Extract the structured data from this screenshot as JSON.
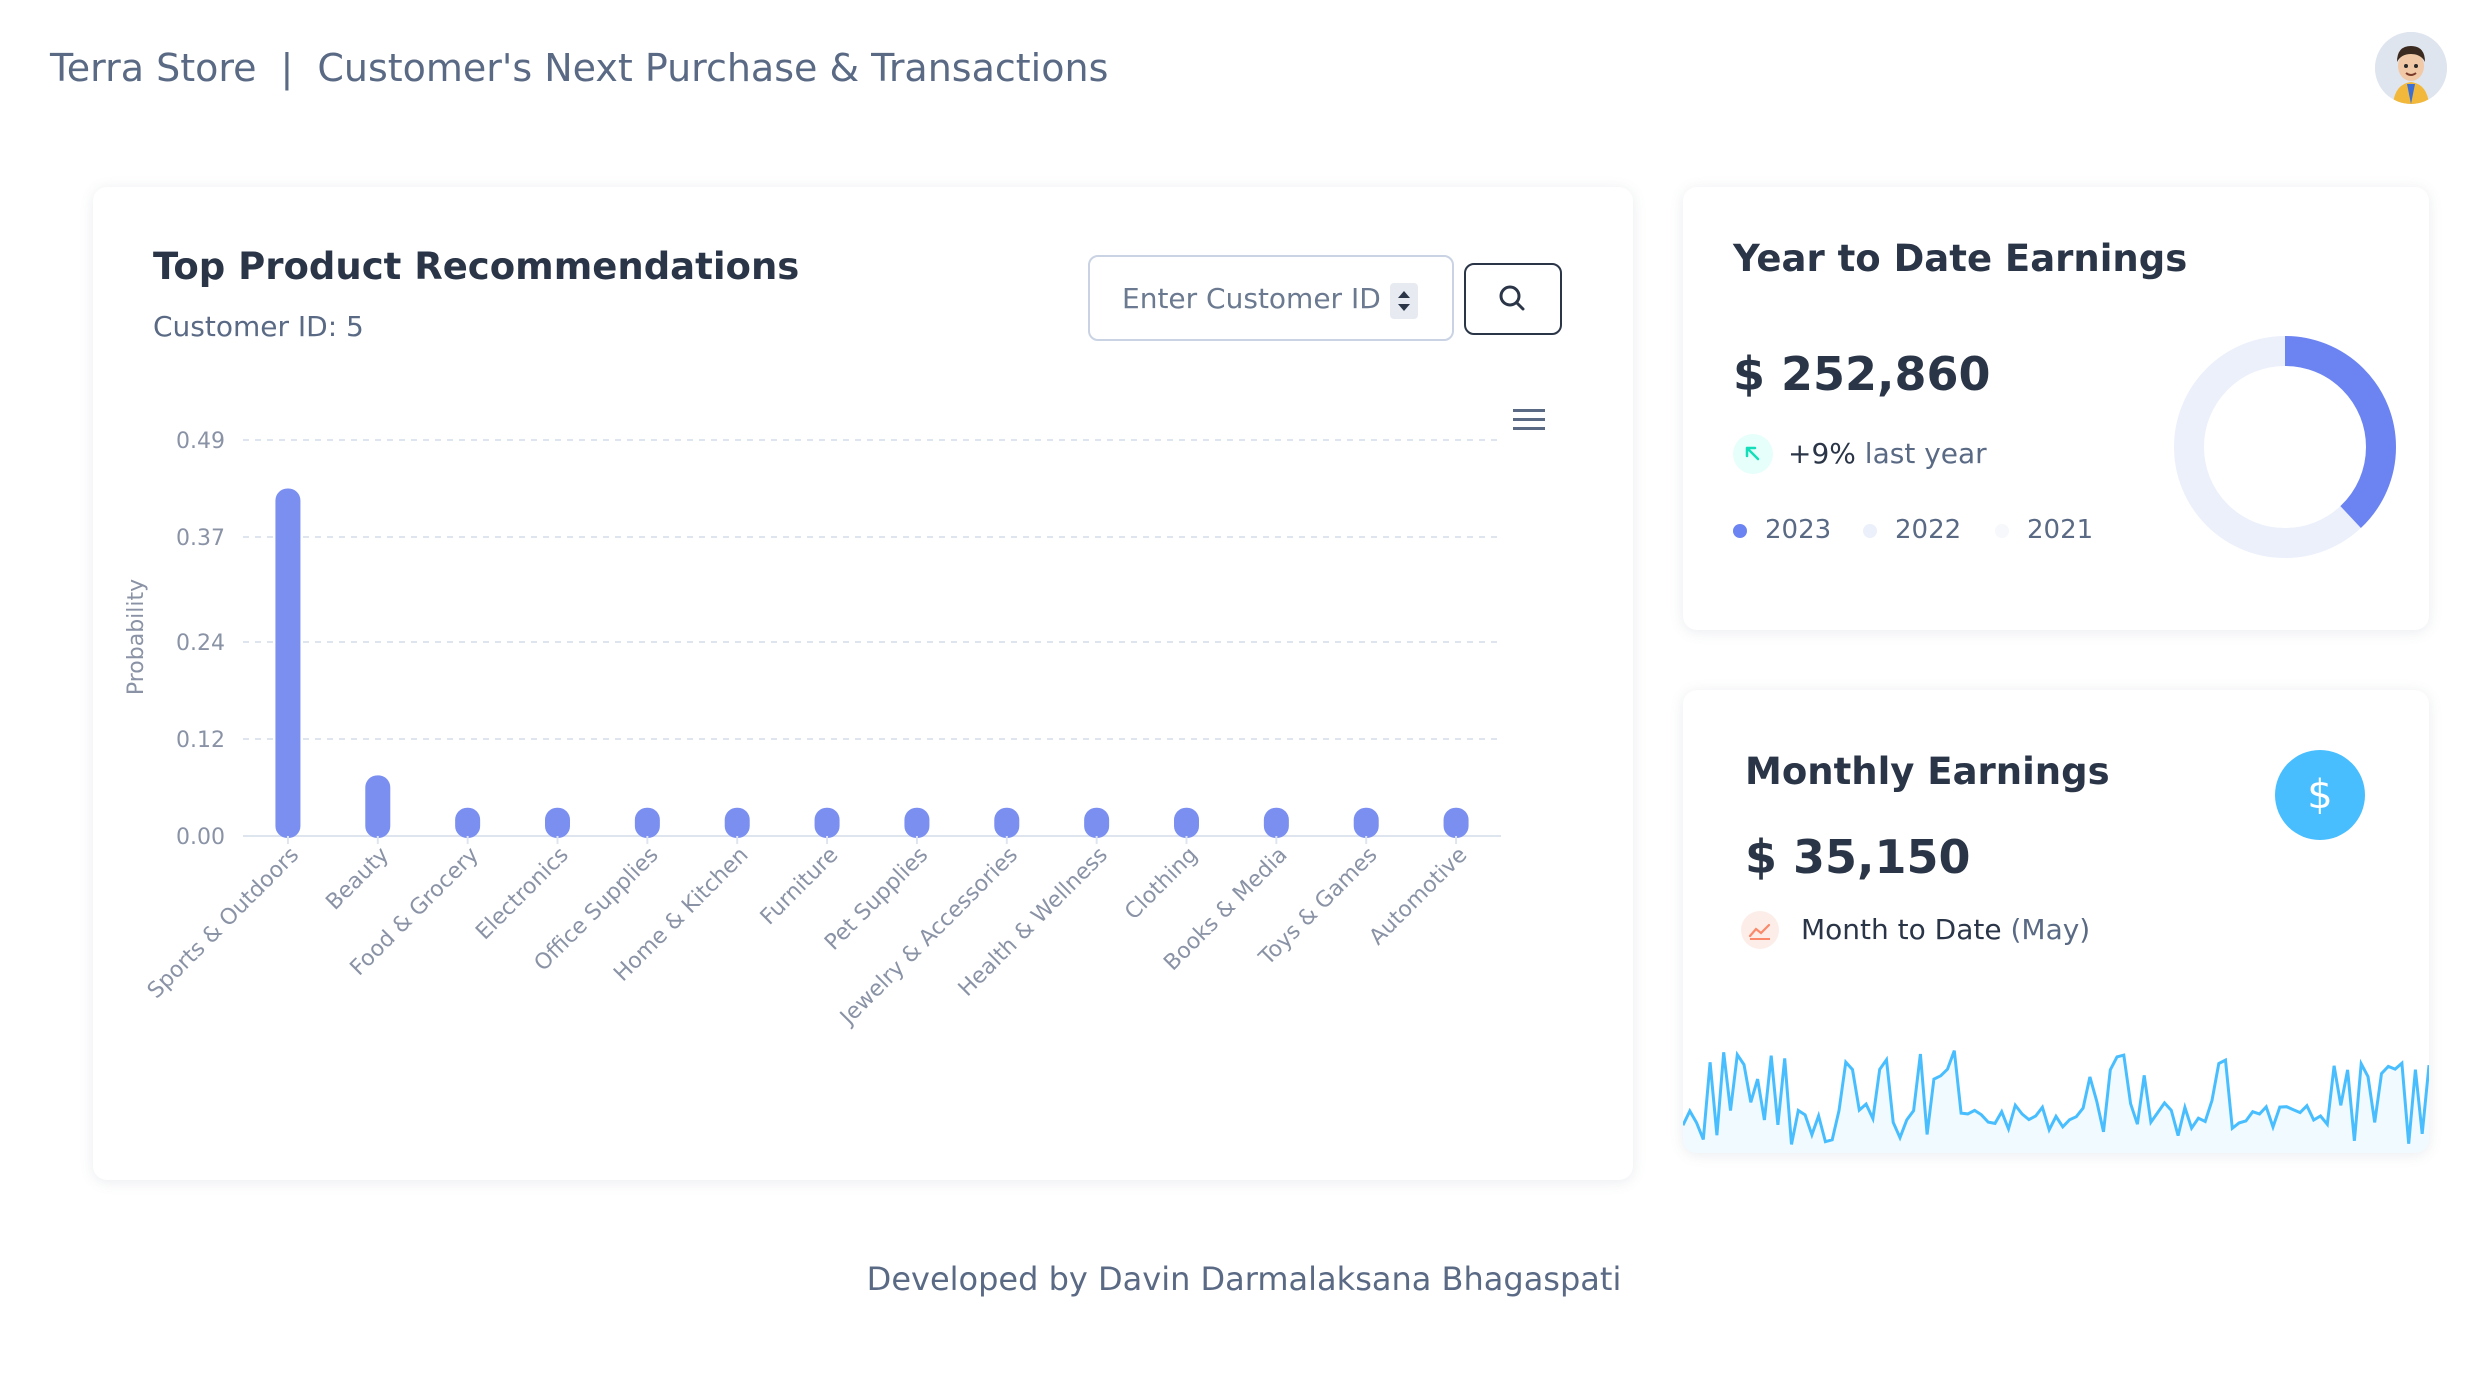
{
  "header": {
    "store_name": "Terra Store",
    "separator": "|",
    "page_title": "Customer's Next Purchase & Transactions",
    "avatar_icon": "user-avatar"
  },
  "recommendations": {
    "title": "Top Product Recommendations",
    "customer_label": "Customer ID: 5",
    "input_placeholder": "Enter Customer ID",
    "input_value": "",
    "search_icon": "search-icon",
    "menu_icon": "hamburger-menu-icon"
  },
  "chart_data": {
    "type": "bar",
    "ylabel": "Probability",
    "ylim": [
      0,
      0.49
    ],
    "yticks": [
      "0.00",
      "0.12",
      "0.24",
      "0.37",
      "0.49"
    ],
    "categories": [
      "Sports & Outdoors",
      "Beauty",
      "Food & Grocery",
      "Electronics",
      "Office Supplies",
      "Home & Kitchen",
      "Furniture",
      "Pet Supplies",
      "Jewelry & Accessories",
      "Health & Wellness",
      "Clothing",
      "Books & Media",
      "Toys & Games",
      "Automotive"
    ],
    "values": [
      0.43,
      0.075,
      0.035,
      0.035,
      0.035,
      0.035,
      0.035,
      0.035,
      0.035,
      0.035,
      0.035,
      0.035,
      0.035,
      0.035
    ],
    "bar_color": "#7a8ff0",
    "grid": true
  },
  "ytd": {
    "title": "Year to Date Earnings",
    "amount": "$ 252,860",
    "change": "+9%",
    "change_label": "last year",
    "legend": [
      {
        "label": "2023",
        "color": "#6c84f2"
      },
      {
        "label": "2022",
        "color": "#ecf0fb"
      },
      {
        "label": "2021",
        "color": "#f7f8fb"
      }
    ],
    "donut": {
      "2023": 38,
      "2022": 62,
      "2021": 0
    }
  },
  "monthly": {
    "title": "Monthly Earnings",
    "amount": "$ 35,150",
    "period_label": "Month to Date",
    "period_value": "(May)",
    "badge_icon": "dollar-icon",
    "line_color": "#49beff"
  },
  "footer": {
    "credit": "Developed by Davin Darmalaksana Bhagaspati"
  }
}
